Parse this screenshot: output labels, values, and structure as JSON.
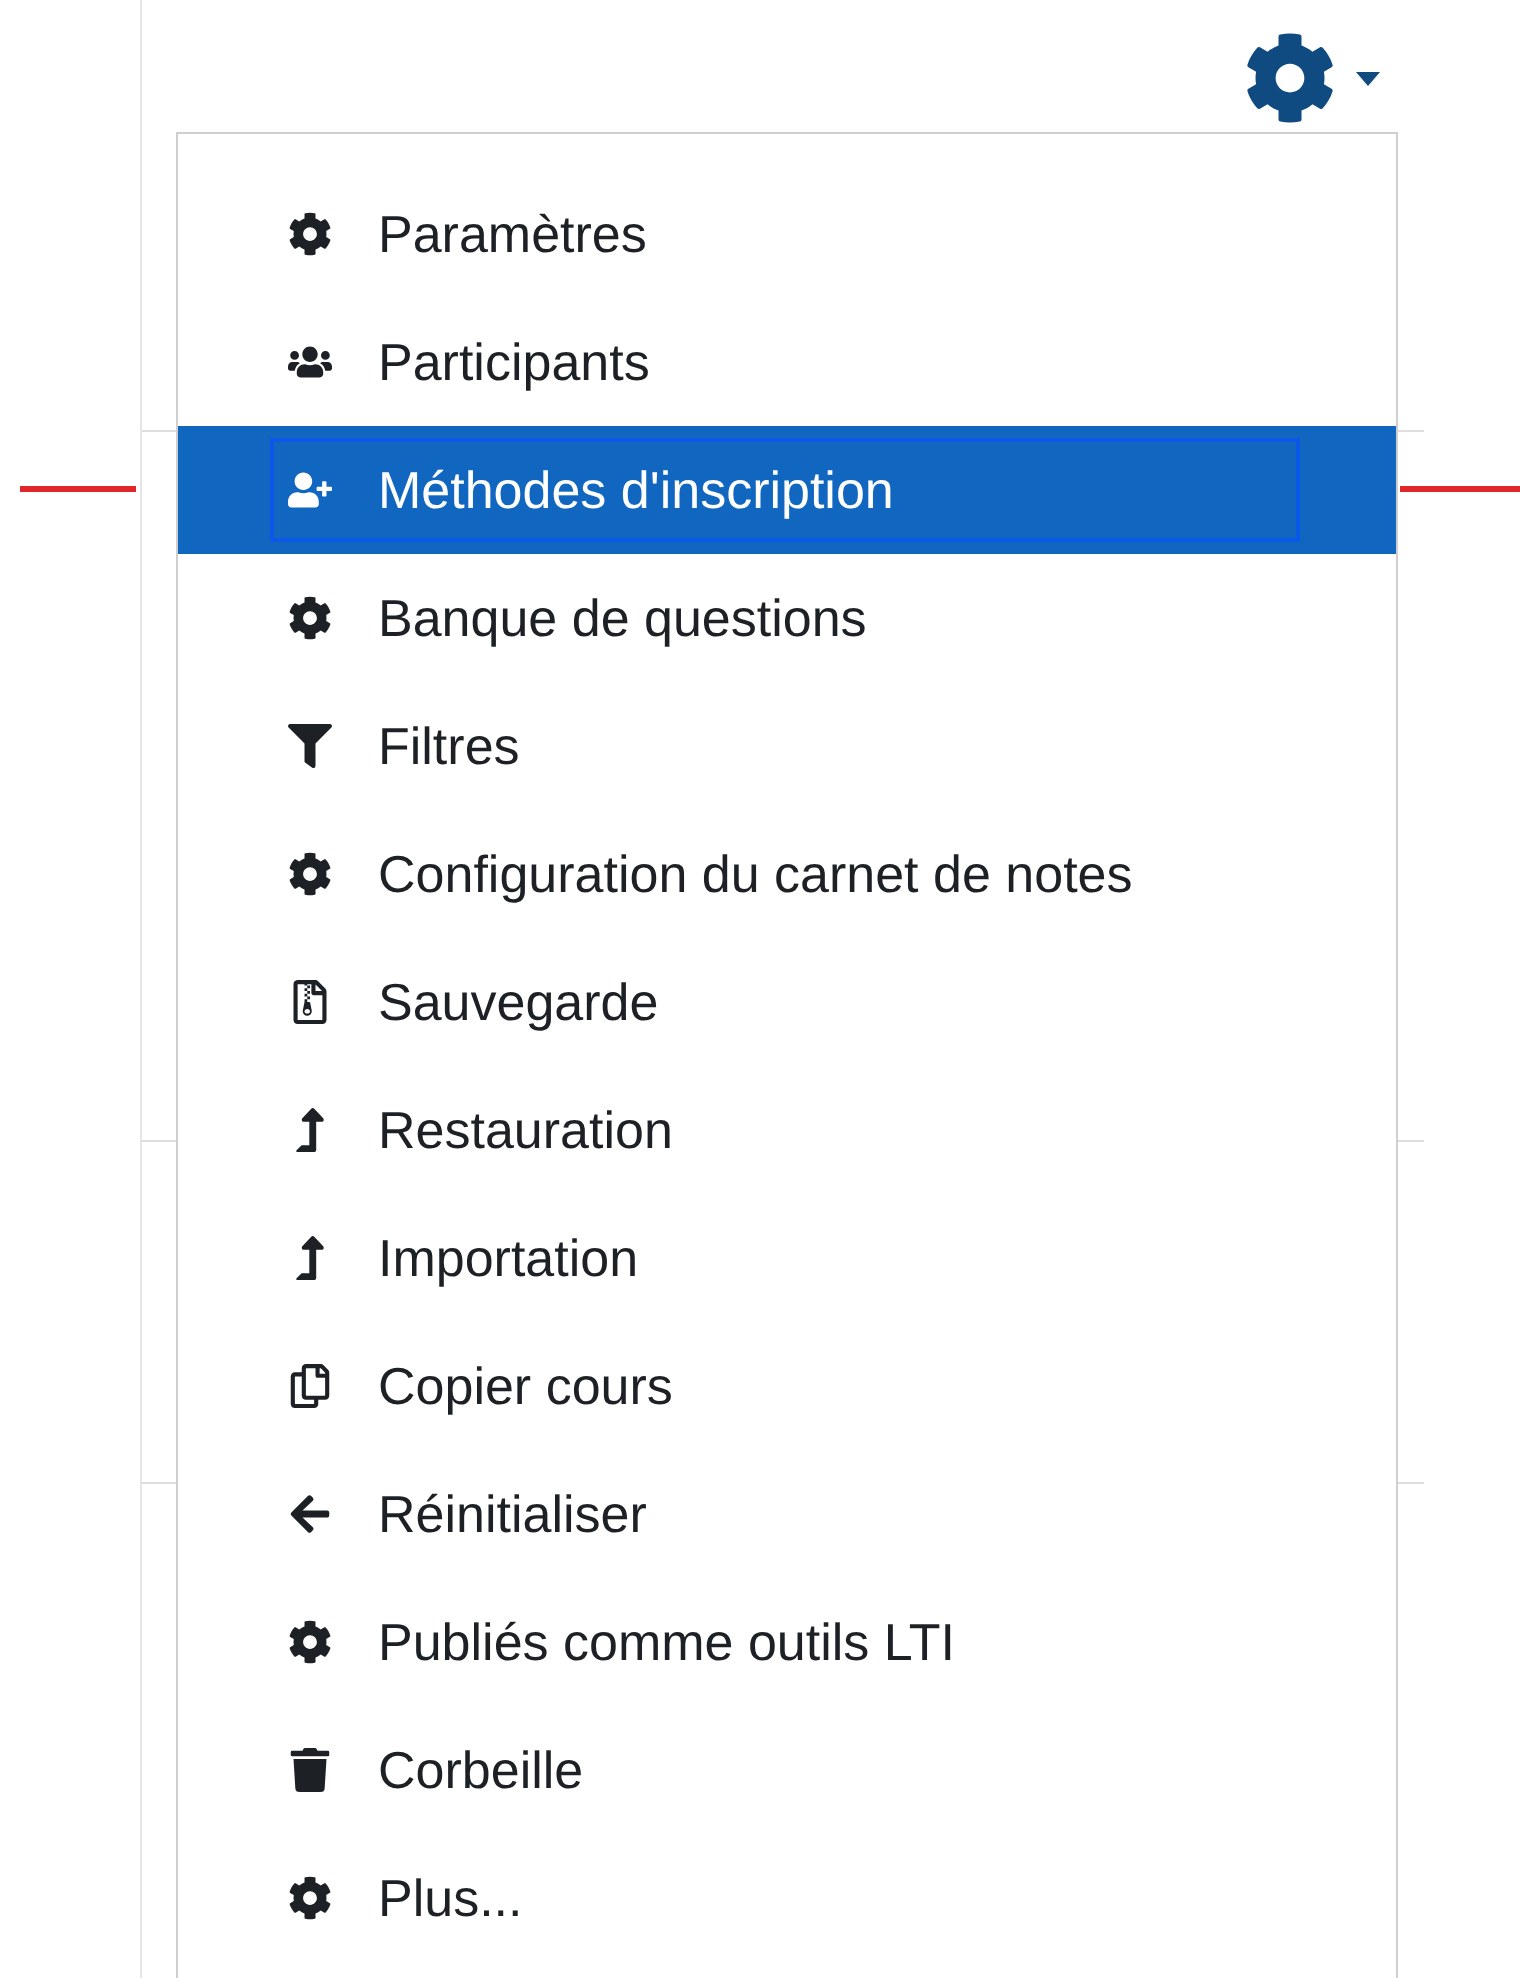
{
  "settings_menu": {
    "items": [
      {
        "label": "Paramètres",
        "selected": false
      },
      {
        "label": "Participants",
        "selected": false
      },
      {
        "label": "Méthodes d'inscription",
        "selected": true
      },
      {
        "label": "Banque de questions",
        "selected": false
      },
      {
        "label": "Filtres",
        "selected": false
      },
      {
        "label": "Configuration du carnet de notes",
        "selected": false
      },
      {
        "label": "Sauvegarde",
        "selected": false
      },
      {
        "label": "Restauration",
        "selected": false
      },
      {
        "label": "Importation",
        "selected": false
      },
      {
        "label": "Copier cours",
        "selected": false
      },
      {
        "label": "Réinitialiser",
        "selected": false
      },
      {
        "label": "Publiés comme outils LTI",
        "selected": false
      },
      {
        "label": "Corbeille",
        "selected": false
      },
      {
        "label": "Plus...",
        "selected": false
      }
    ]
  }
}
